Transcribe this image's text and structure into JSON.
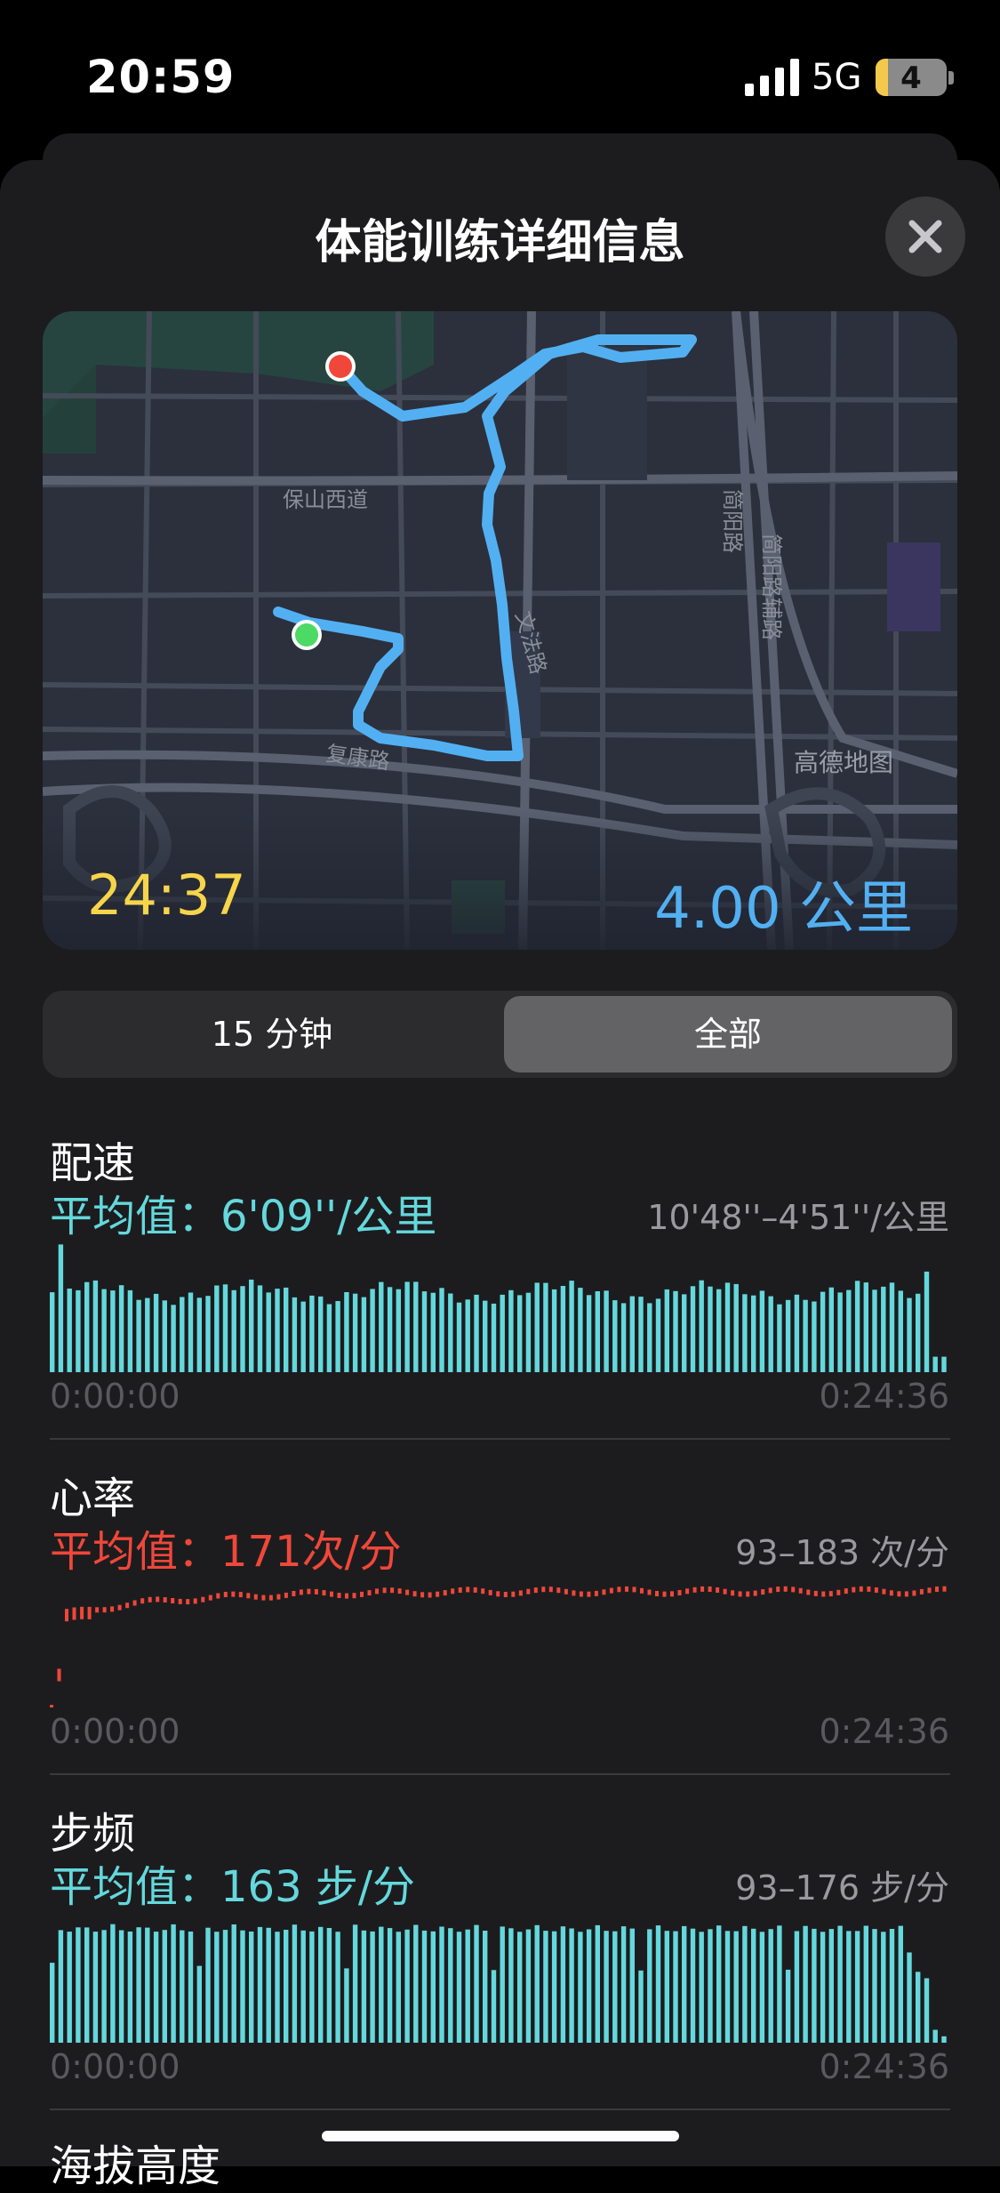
{
  "status_bar": {
    "time": "20:59",
    "network": "5G",
    "battery": "4"
  },
  "header": {
    "title": "体能训练详细信息"
  },
  "map": {
    "duration": "24:37",
    "distance": "4.00 公里",
    "streets": [
      "保山西道",
      "简阳路",
      "简阳路辅路",
      "文法路",
      "复康路"
    ],
    "watermark": "高德地图",
    "route_color": "#52b0f2",
    "start_marker_color": "#4cd964",
    "end_marker_color": "#f0473a"
  },
  "segment": {
    "options": [
      "15 分钟",
      "全部"
    ],
    "selected": "全部"
  },
  "metrics": {
    "pace": {
      "title": "配速",
      "average": "平均值：6'09''/公里",
      "range": "10'48''–4'51''/公里",
      "start": "0:00:00",
      "end": "0:24:36",
      "color": "#64d8dc"
    },
    "heart_rate": {
      "title": "心率",
      "average": "平均值：171次/分",
      "range": "93–183 次/分",
      "start": "0:00:00",
      "end": "0:24:36",
      "color": "#f0473a"
    },
    "cadence": {
      "title": "步频",
      "average": "平均值：163 步/分",
      "range": "93–176 步/分",
      "start": "0:00:00",
      "end": "0:24:36",
      "color": "#64d8dc"
    },
    "elevation": {
      "title": "海拔高度"
    }
  }
}
